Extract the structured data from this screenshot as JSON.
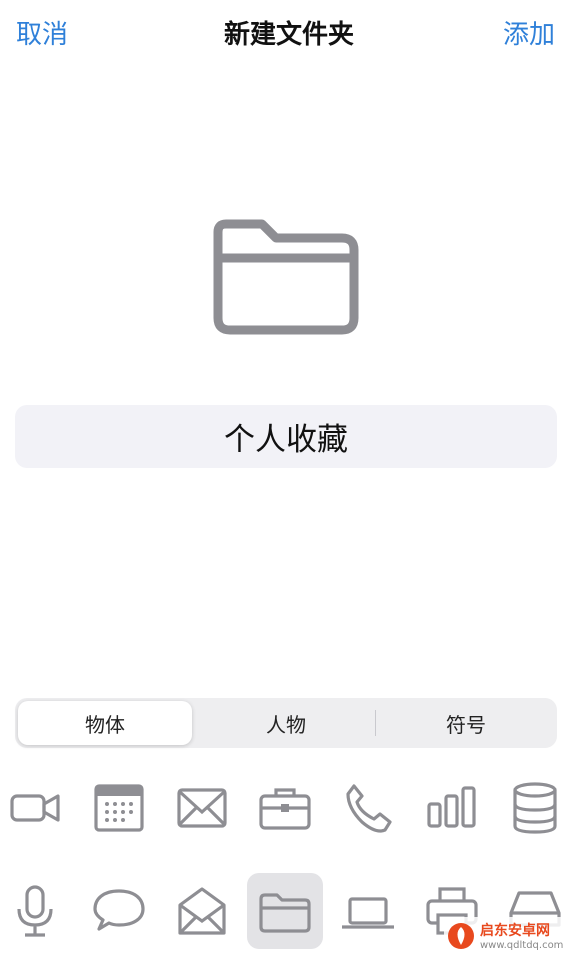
{
  "nav": {
    "cancel_label": "取消",
    "title": "新建文件夹",
    "add_label": "添加"
  },
  "folder_name": {
    "value": "个人收藏"
  },
  "segments": [
    {
      "label": "物体",
      "selected": true
    },
    {
      "label": "人物",
      "selected": false
    },
    {
      "label": "符号",
      "selected": false
    }
  ],
  "icon_rows": [
    [
      "video-camera-icon",
      "calendar-icon",
      "envelope-icon",
      "briefcase-icon",
      "phone-icon",
      "bar-chart-icon",
      "database-icon"
    ],
    [
      "microphone-icon",
      "speech-bubble-icon",
      "open-envelope-icon",
      "folder-icon",
      "laptop-icon",
      "printer-icon",
      "hard-drive-icon"
    ]
  ],
  "selected_icon": "folder-icon",
  "watermark": {
    "title": "启东安卓网",
    "url": "www.qdltdq.com"
  },
  "colors": {
    "accent": "#2f80d9",
    "icon_gray": "#8e8e93",
    "field_bg": "#f2f2f7"
  }
}
